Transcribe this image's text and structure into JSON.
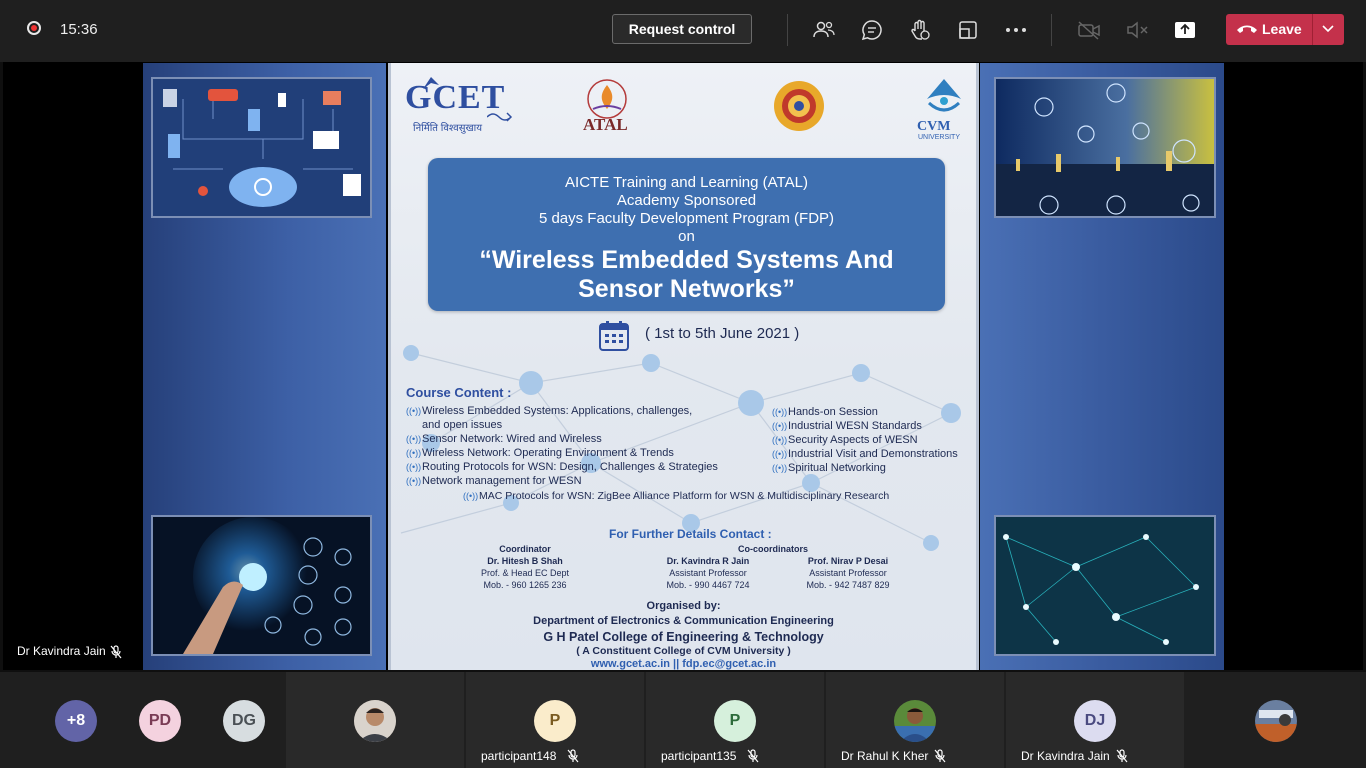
{
  "topbar": {
    "time": "15:36",
    "request_control": "Request control",
    "leave": "Leave",
    "icons": [
      "participants-icon",
      "chat-icon",
      "raise-hand-icon",
      "view-icon",
      "more-icon",
      "camera-off-icon",
      "mic-off-icon",
      "share-icon"
    ]
  },
  "poster": {
    "logo_gcet": "GCET",
    "logo_gcet_tagline": "निर्मिति विश्वसुखाय",
    "logo_atal": "ATAL",
    "logo_cvm": "CVM",
    "logo_cvm_sub": "UNIVERSITY",
    "banner": {
      "line1": "AICTE Training and Learning (ATAL)",
      "line2": "Academy Sponsored",
      "line3": "5 days Faculty Development Program (FDP)",
      "line4": "on",
      "title1": "“Wireless Embedded Systems And",
      "title2": "Sensor Networks”"
    },
    "date": "( 1st to 5th June 2021 )",
    "course_title": "Course Content :",
    "left_items": [
      "Wireless Embedded Systems: Applications, challenges,",
      "and open issues",
      "Sensor Network: Wired and Wireless",
      "Wireless Network: Operating Environment & Trends",
      "Routing Protocols for WSN: Design, Challenges & Strategies",
      "Network management for WESN"
    ],
    "right_items": [
      "Hands-on Session",
      "Industrial WESN Standards",
      "Security Aspects of WESN",
      "Industrial Visit and Demonstrations",
      "Spiritual Networking"
    ],
    "bottom_item": "MAC Protocols for WSN: ZigBee Alliance Platform for WSN & Multidisciplinary Research",
    "contact_title": "For Further Details Contact :",
    "coordinator": {
      "role": "Coordinator",
      "name": "Dr. Hitesh B Shah",
      "title": "Prof. & Head EC Dept",
      "mob": "Mob. - 960 1265 236"
    },
    "co_role": "Co-coordinators",
    "co1": {
      "name": "Dr. Kavindra R Jain",
      "title": "Assistant Professor",
      "mob": "Mob. - 990 4467 724"
    },
    "co2": {
      "name": "Prof. Nirav P Desai",
      "title": "Assistant Professor",
      "mob": "Mob. - 942 7487 829"
    },
    "organised_by": "Organised by:",
    "dept": "Department of Electronics & Communication Engineering",
    "college": "G H Patel College of Engineering & Technology",
    "constituent": "( A Constituent College of CVM University )",
    "links": "www.gcet.ac.in  ||  fdp.ec@gcet.ac.in"
  },
  "presenter_name": "Dr Kavindra Jain",
  "participants": {
    "overflow": "+8",
    "pd": "PD",
    "dg": "DG",
    "p148_initial": "P",
    "p148_name": "participant148",
    "p135_initial": "P",
    "p135_name": "participant135",
    "rahul_name": "Dr Rahul K Kher",
    "dj": "DJ",
    "dj_name": "Dr Kavindra Jain"
  },
  "colors": {
    "leave": "#c4314b",
    "topbar": "#1f1f1f",
    "overflow_avatar": "#6264a7"
  }
}
